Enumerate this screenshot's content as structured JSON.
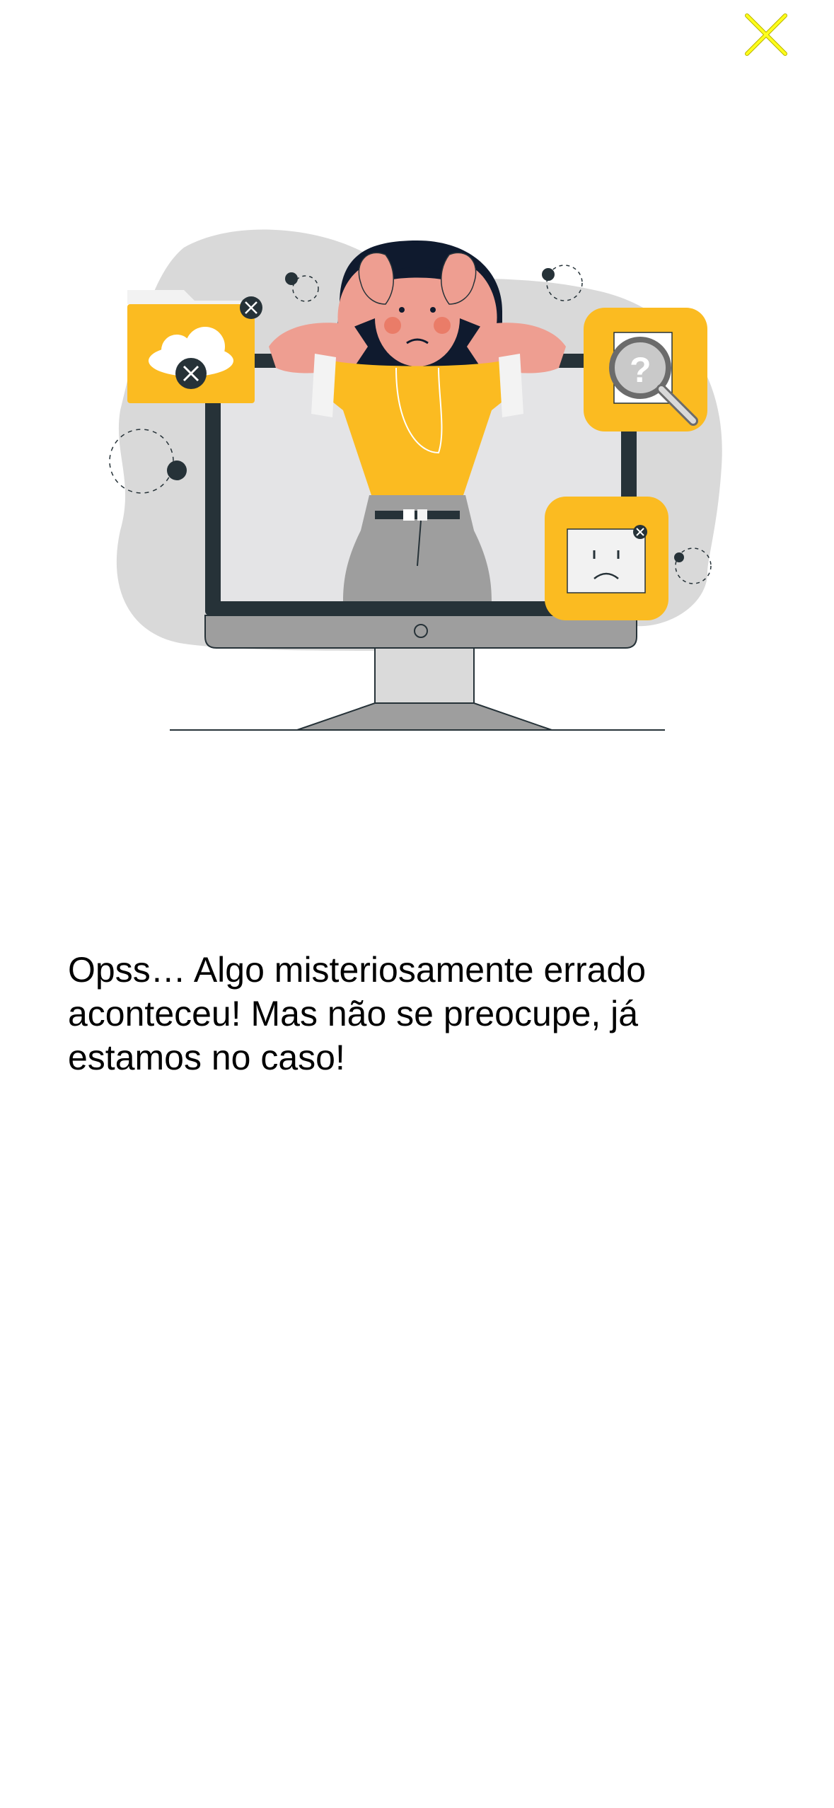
{
  "screen": {
    "background_color": "#ffffff"
  },
  "close_button": {
    "icon": "close-icon",
    "color": "#ffff00"
  },
  "illustration": {
    "description_icon": "error-illustration",
    "accent_color": "#fbbb21",
    "dark_color": "#263238"
  },
  "error": {
    "message": "Opss… Algo misteriosamente errado aconteceu! Mas não se preocupe, já estamos no caso!"
  }
}
